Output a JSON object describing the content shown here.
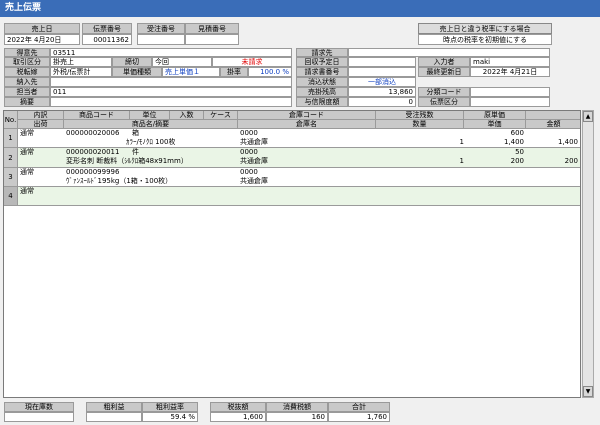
{
  "window": {
    "title": "売上伝票"
  },
  "header": {
    "sales_date_label": "売上日",
    "sales_date": "2022年 4月20日",
    "slip_no_label": "伝票番号",
    "slip_no": "00011362",
    "order_no_label": "受注番号",
    "estimate_no_label": "見積番号",
    "tax_rate_button": "売上日と違う税率にする場合",
    "tax_rate_note": "時点の税率を初期値にする"
  },
  "customer": {
    "label": "得意先",
    "code": "03511",
    "billing_label": "請求先",
    "transaction_type_label": "取引区分",
    "transaction_type": "掛売上",
    "closing_label": "締切",
    "closing": "今回",
    "unbilled": "未請求",
    "collection_date_label": "回収予定日",
    "inputter_label": "入力者",
    "inputter": "maki",
    "tax_calc_label": "税転嫁",
    "tax_calc": "外税/伝票計",
    "price_type_label": "単価種類",
    "price_type": "売上単価１",
    "rate_label": "掛率",
    "rate": "100.0 %",
    "invoice_no_label": "請求書番号",
    "last_updated_label": "最終更新日",
    "last_updated": "2022年 4月21日",
    "delivery_label": "納入先",
    "clear_status_label": "消込状態",
    "clear_status": "一部消込",
    "staff_label": "担当者",
    "staff_code": "011",
    "sales_balance_label": "売掛残高",
    "sales_balance": "13,860",
    "category_code_label": "分類コード",
    "summary_label": "摘要",
    "credit_limit_label": "与信限度額",
    "credit_limit": "0",
    "slip_category_label": "伝票区分"
  },
  "grid": {
    "headers_top": [
      "No.",
      "内訳",
      "商品コード",
      "単位",
      "入数",
      "ケース",
      "倉庫コード",
      "受注残数",
      "原単価",
      ""
    ],
    "headers_bottom": [
      "",
      "出荷",
      "商品名/摘要",
      "",
      "",
      "",
      "倉庫名",
      "数量",
      "単価",
      "金額"
    ],
    "rows": [
      {
        "no": "1",
        "type": "通常",
        "code": "000000020006",
        "unit": "箱",
        "name": "",
        "spec": "ｶﾗｰ/ﾓﾉｸﾛ 100枚",
        "wh_code": "0000",
        "wh_name": "共通倉庫",
        "cost": "600",
        "qty": "1",
        "price": "1,400",
        "amount": "1,400"
      },
      {
        "no": "2",
        "type": "通常",
        "code": "000000020011",
        "unit": "件",
        "name": "変形名刺 断裁料（ｼﾙｸﾛ箱48x91mm）",
        "spec": "",
        "wh_code": "0000",
        "wh_name": "共通倉庫",
        "cost": "50",
        "qty": "1",
        "price": "200",
        "amount": "200"
      },
      {
        "no": "3",
        "type": "通常",
        "code": "000000099996",
        "unit": "",
        "name": "ｳﾞｧﾝｽｰﾙﾄﾞ195kg（1箱・100枚）",
        "spec": "",
        "wh_code": "0000",
        "wh_name": "共通倉庫",
        "cost": "",
        "qty": "",
        "price": "",
        "amount": ""
      },
      {
        "no": "4",
        "type": "通常",
        "code": "",
        "unit": "",
        "name": "",
        "spec": "",
        "wh_code": "",
        "wh_name": "",
        "cost": "",
        "qty": "",
        "price": "",
        "amount": ""
      }
    ]
  },
  "footer": {
    "stock_label": "現在庫数",
    "gross_profit_label": "粗利益",
    "gross_margin_label": "粗利益率",
    "gross_margin": "59.4 %",
    "pretax_label": "税抜額",
    "pretax": "1,600",
    "tax_label": "消費税額",
    "tax": "160",
    "total_label": "合計",
    "total": "1,760"
  },
  "colors": {
    "titlebar": "#3a6db8",
    "row_alt": "#eaf5e6",
    "unbilled": "#e00000",
    "price_type": "#1040c0"
  }
}
